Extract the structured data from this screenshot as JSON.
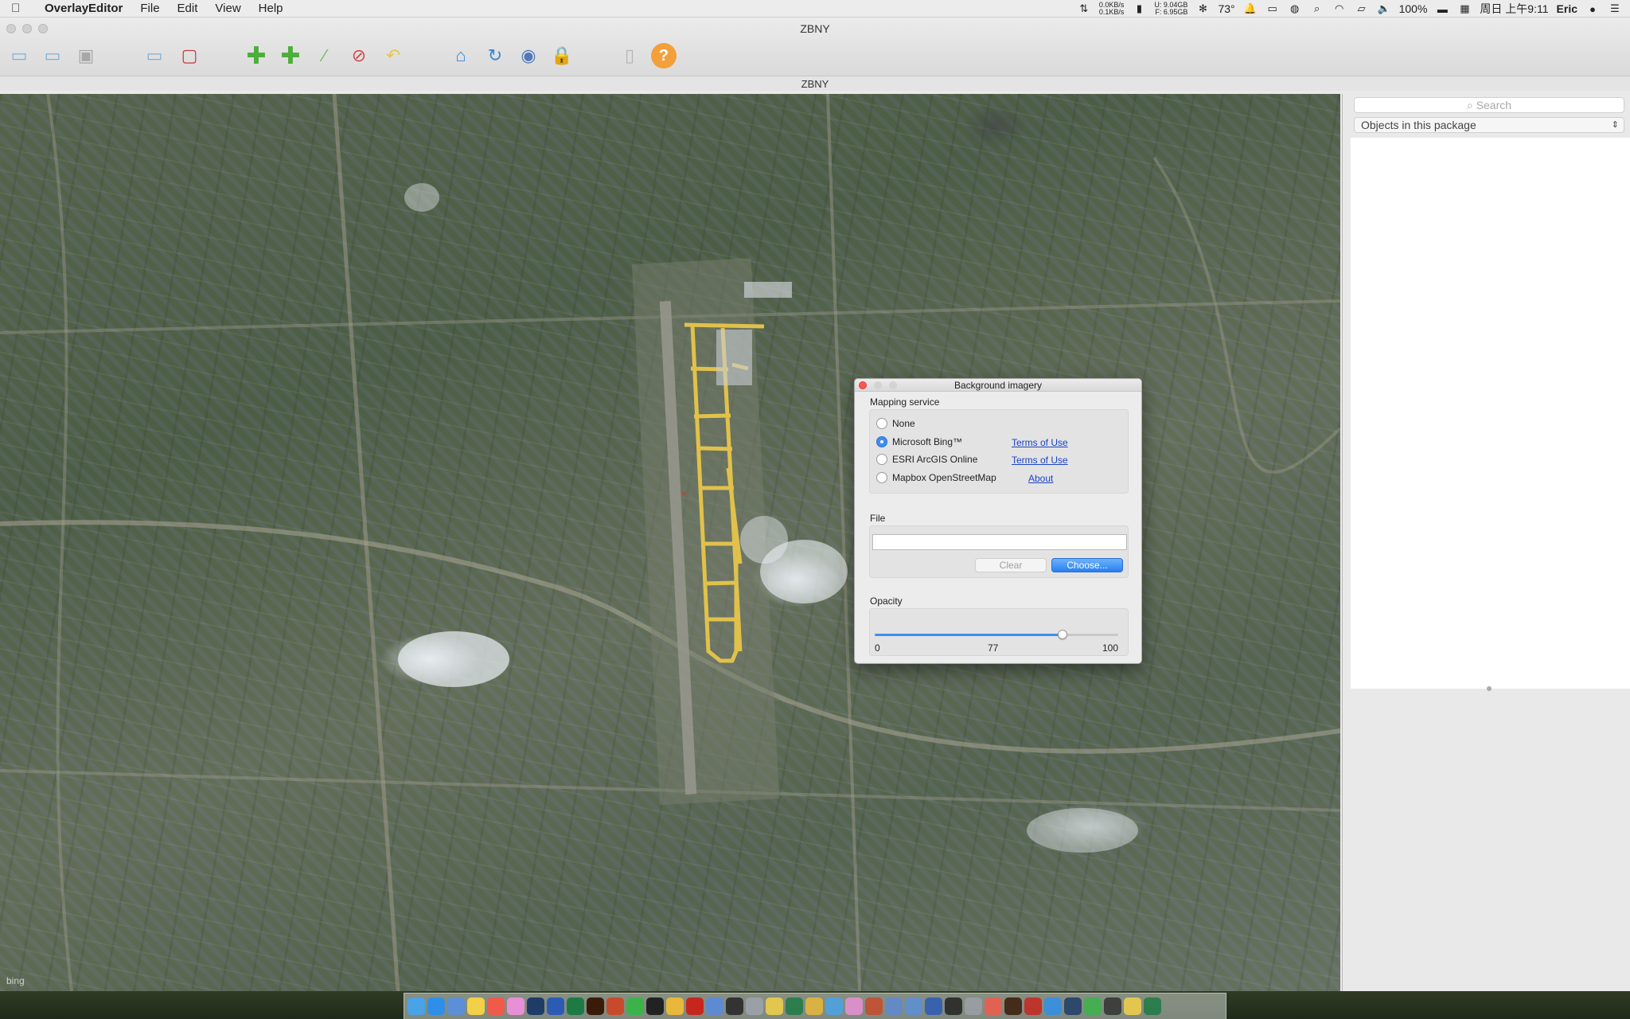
{
  "menubar": {
    "app_name": "OverlayEditor",
    "menus": [
      "File",
      "Edit",
      "View",
      "Help"
    ],
    "net_up": "0.0KB/s",
    "net_down": "0.1KB/s",
    "mem_used": "U: 9.04GB",
    "mem_free": "F: 6.95GB",
    "temperature": "73°",
    "battery": "100%",
    "datetime": "周日 上午9:11",
    "user": "Eric"
  },
  "window": {
    "title": "ZBNY",
    "doc_title": "ZBNY"
  },
  "toolbar": {
    "icons": [
      "new-package-icon",
      "open-package-icon",
      "save-package-icon",
      "import-icon",
      "export-icon",
      "add-object-icon",
      "add-facade-icon",
      "edit-path-icon",
      "delete-icon",
      "undo-icon",
      "locate-icon",
      "rotate-icon",
      "background-imagery-icon",
      "lock-icon",
      "blank-icon",
      "help-icon"
    ]
  },
  "sidepanel": {
    "search_placeholder": "Search",
    "objects_selector": "Objects in this package"
  },
  "map": {
    "attribution": "bing"
  },
  "dialog": {
    "title": "Background imagery",
    "mapping_label": "Mapping service",
    "services": [
      {
        "label": "None",
        "selected": false,
        "link": ""
      },
      {
        "label": "Microsoft Bing™",
        "selected": true,
        "link": "Terms of Use"
      },
      {
        "label": "ESRI ArcGIS Online",
        "selected": false,
        "link": "Terms of Use"
      },
      {
        "label": "Mapbox OpenStreetMap",
        "selected": false,
        "link": "About"
      }
    ],
    "file_label": "File",
    "file_value": "",
    "clear_label": "Clear",
    "choose_label": "Choose...",
    "opacity_label": "Opacity",
    "opacity": {
      "min": "0",
      "value": "77",
      "max": "100",
      "fraction": 0.77
    }
  },
  "colors": {
    "accent": "#3d8ef3",
    "link": "#1a44c8",
    "close_red": "#fc5753",
    "runway_yellow": "#e8c64a"
  },
  "dock": {
    "apps": [
      "Finder",
      "Safari",
      "Mail",
      "Notes",
      "Calendar",
      "Photos",
      "Steam",
      "Word",
      "Excel",
      "Illustrator",
      "PowerPoint",
      "WeChat",
      "QQ",
      "Chrome",
      "Acrobat",
      "Preview",
      "Terminal",
      "Trash"
    ]
  }
}
